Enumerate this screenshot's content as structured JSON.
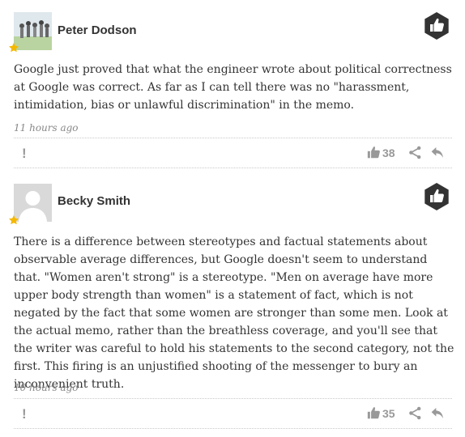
{
  "comments": [
    {
      "author": "Peter Dodson",
      "avatar_icon": "group-photo-avatar",
      "text": "Google just proved that what the engineer wrote about political correctness at Google was correct.   As far as I can tell there was no \"harassment, intimidation, bias or unlawful discrimination\" in the memo.",
      "timestamp": "11 hours ago",
      "like_count": "38",
      "flag_label": "!"
    },
    {
      "author": "Becky Smith",
      "avatar_icon": "default-user-avatar",
      "text": "There is a difference between stereotypes and factual statements about observable average differences, but Google doesn't seem to understand that. \"Women aren't strong\" is a stereotype. \"Men on average have more upper body strength than women\" is a statement of fact, which is not negated by the fact that some women are stronger than some men. Look at the actual memo, rather than the breathless coverage, and you'll see that the writer was careful to hold his statements to the second category, not the first. This firing is an unjustified shooting of the messenger to bury an inconvenient truth.",
      "timestamp": "10 hours ago",
      "like_count": "35",
      "flag_label": "!"
    }
  ],
  "colors": {
    "badge": "#333333",
    "star": "#f5b800",
    "muted": "#999999",
    "text": "#333333",
    "timestamp": "#888888"
  },
  "icons": [
    "thumbs-up-icon",
    "star-icon",
    "flag-icon",
    "share-icon",
    "reply-icon"
  ]
}
